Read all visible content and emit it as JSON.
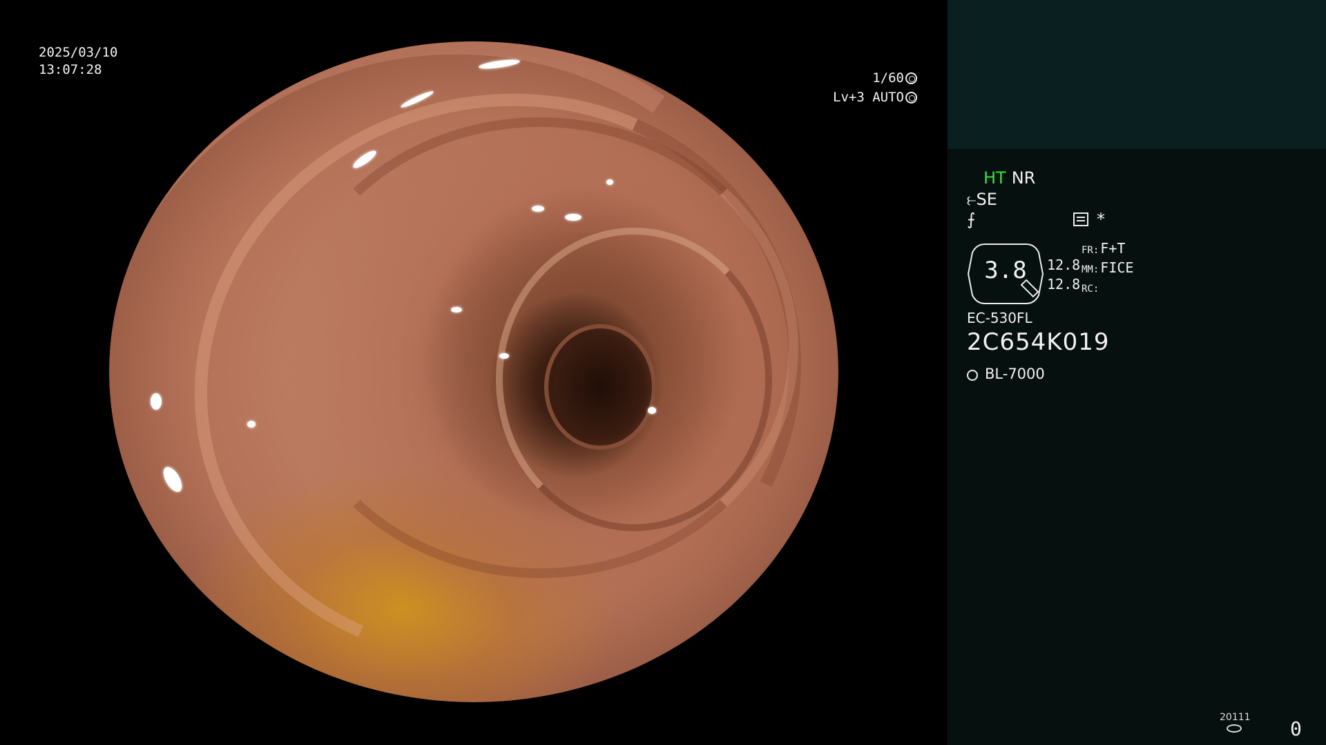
{
  "viewport": {
    "date": "2025/03/10",
    "time": "13:07:28",
    "shutter": "1/60",
    "level": "Lv+3 AUTO",
    "shutter_icon": "aperture-icon",
    "auto_icon": "iris-icon"
  },
  "panel": {
    "ht": "HT",
    "nr": "NR",
    "se": "SE",
    "se_icon": "pump-icon",
    "mode_icon": "edge-enhance-icon",
    "list_icon": "menu-icon",
    "star": "*",
    "zoom": "3.8",
    "zoom_nums": [
      "12.8",
      "12.8"
    ],
    "params": [
      {
        "key": "FR:",
        "value": "F+T"
      },
      {
        "key": "MM:",
        "value": "FICE"
      },
      {
        "key": "RC:",
        "value": ""
      }
    ],
    "scope_model": "EC-530FL",
    "scope_serial": "2C654K019",
    "light_source": "BL-7000",
    "light_icon": "sun-icon",
    "counter_label": "20111",
    "counter_icon": "disk-icon",
    "count": "0"
  },
  "colors": {
    "background": "#000000",
    "panel": "#06100f",
    "panel_top": "#0a1f1f",
    "ht_green": "#39e13c",
    "text": "#f2f2f2"
  }
}
